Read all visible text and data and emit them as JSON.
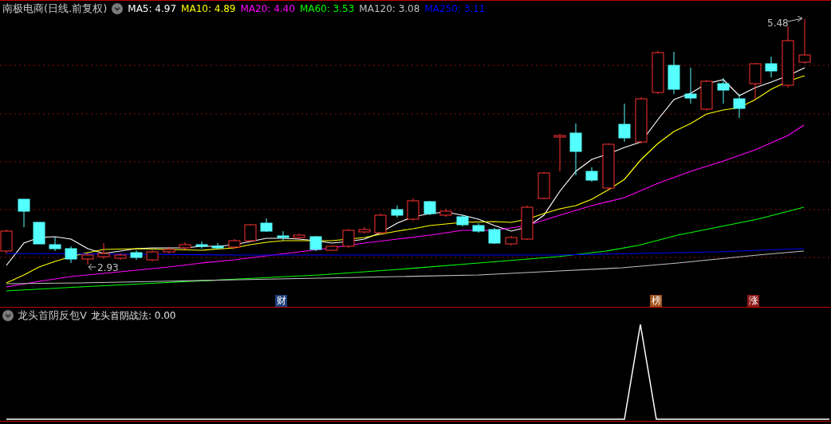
{
  "header": {
    "title": "南极电商(日线.前复权)",
    "indicators": [
      {
        "label": "MA5: 4.97",
        "color": "#ffffff"
      },
      {
        "label": "MA10: 4.89",
        "color": "#ffff00"
      },
      {
        "label": "MA20: 4.40",
        "color": "#ff00ff"
      },
      {
        "label": "MA60: 3.53",
        "color": "#00ff00"
      },
      {
        "label": "MA120: 3.08",
        "color": "#c0c0c0"
      },
      {
        "label": "MA250: 3.11",
        "color": "#0000ff"
      }
    ]
  },
  "price_labels": [
    {
      "kind": "high",
      "text": "5.48"
    },
    {
      "kind": "low",
      "text": "2.93"
    }
  ],
  "event_markers": [
    {
      "text": "财",
      "color": "#1e3f7a"
    },
    {
      "text": "榜",
      "color": "#a0521a"
    },
    {
      "text": "涨",
      "color": "#8b1a1a"
    }
  ],
  "sub_panel": {
    "title": "龙头首阴反包V",
    "value_label": "龙头首阴战法: 0.00"
  }
}
